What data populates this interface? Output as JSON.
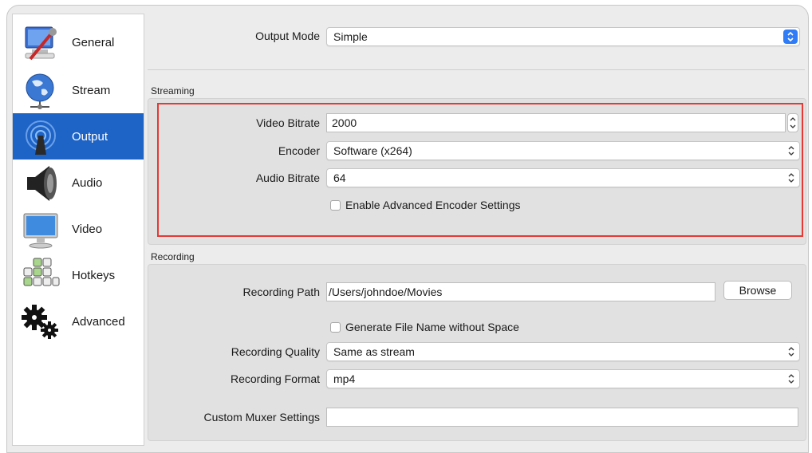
{
  "sidebar": {
    "items": [
      {
        "label": "General",
        "icon": "general-settings-icon"
      },
      {
        "label": "Stream",
        "icon": "globe-stream-icon"
      },
      {
        "label": "Output",
        "icon": "antenna-broadcast-icon",
        "active": true
      },
      {
        "label": "Audio",
        "icon": "speaker-icon"
      },
      {
        "label": "Video",
        "icon": "monitor-icon"
      },
      {
        "label": "Hotkeys",
        "icon": "keyboard-icon"
      },
      {
        "label": "Advanced",
        "icon": "gears-icon"
      }
    ]
  },
  "output_mode": {
    "label": "Output Mode",
    "value": "Simple"
  },
  "streaming": {
    "title": "Streaming",
    "video_bitrate": {
      "label": "Video Bitrate",
      "value": "2000"
    },
    "encoder": {
      "label": "Encoder",
      "value": "Software (x264)"
    },
    "audio_bitrate": {
      "label": "Audio Bitrate",
      "value": "64"
    },
    "advanced_checkbox": {
      "label": "Enable Advanced Encoder Settings",
      "checked": false
    }
  },
  "recording": {
    "title": "Recording",
    "path": {
      "label": "Recording Path",
      "value": "/Users/johndoe/Movies"
    },
    "browse_label": "Browse",
    "no_space_checkbox": {
      "label": "Generate File Name without Space",
      "checked": false
    },
    "quality": {
      "label": "Recording Quality",
      "value": "Same as stream"
    },
    "format": {
      "label": "Recording Format",
      "value": "mp4"
    },
    "muxer": {
      "label": "Custom Muxer Settings",
      "value": ""
    }
  },
  "colors": {
    "accent": "#1e63c6",
    "highlight": "#e53935",
    "select_arrow_blue": "#2f7cf6"
  }
}
